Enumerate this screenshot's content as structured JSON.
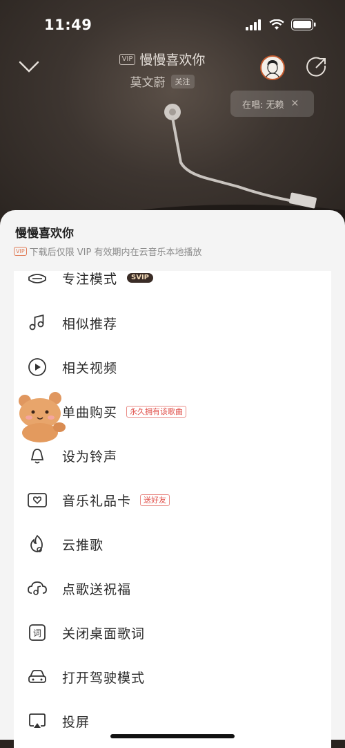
{
  "status_bar": {
    "time": "11:49"
  },
  "player": {
    "vip_label": "VIP",
    "song_title": "慢慢喜欢你",
    "artist": "莫文蔚",
    "follow_label": "关注",
    "singing_label": "在唱: 无赖",
    "singing_close": "✕"
  },
  "sheet": {
    "title": "慢慢喜欢你",
    "vip_label": "VIP",
    "subtitle": "下载后仅限 VIP 有效期内在云音乐本地播放",
    "items": [
      {
        "label": "专注模式",
        "icon": "focus-mode-icon",
        "badge": "SVIP"
      },
      {
        "label": "相似推荐",
        "icon": "similar-music-icon"
      },
      {
        "label": "相关视频",
        "icon": "play-video-icon"
      },
      {
        "label": "单曲购买",
        "icon": "purchase-icon",
        "tag": "永久拥有该歌曲"
      },
      {
        "label": "设为铃声",
        "icon": "ringtone-icon"
      },
      {
        "label": "音乐礼品卡",
        "icon": "gift-card-icon",
        "tag": "送好友"
      },
      {
        "label": "云推歌",
        "icon": "cloud-promote-icon"
      },
      {
        "label": "点歌送祝福",
        "icon": "song-blessing-icon"
      },
      {
        "label": "关闭桌面歌词",
        "icon": "desktop-lyrics-icon"
      },
      {
        "label": "打开驾驶模式",
        "icon": "car-mode-icon"
      },
      {
        "label": "投屏",
        "icon": "screen-cast-icon"
      }
    ]
  },
  "colors": {
    "accent": "#e0504a",
    "sheet_bg": "#f4f4f4",
    "player_bg": "#3d3530"
  }
}
